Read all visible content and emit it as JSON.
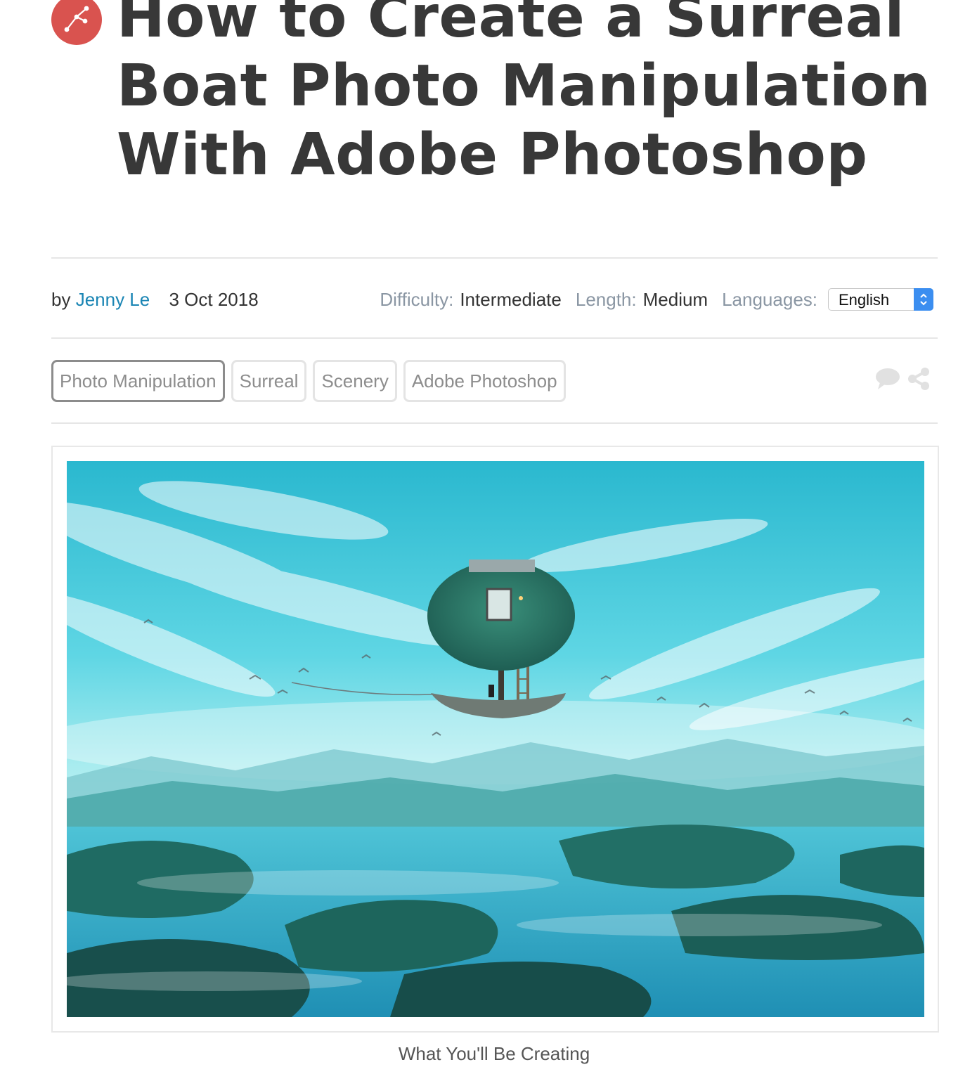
{
  "article": {
    "category_icon": "vector-node-icon",
    "title": "How to Create a Surreal Boat Photo Manipulation With Adobe Photoshop",
    "byline": {
      "by": "by",
      "author": "Jenny Le",
      "date": "3 Oct 2018"
    },
    "meta": {
      "difficulty_label": "Difficulty:",
      "difficulty_value": "Intermediate",
      "length_label": "Length:",
      "length_value": "Medium",
      "languages_label": "Languages:",
      "language_selected": "English"
    },
    "tags": [
      "Photo Manipulation",
      "Surreal",
      "Scenery",
      "Adobe Photoshop"
    ],
    "actions": {
      "comment_icon": "comment-icon",
      "share_icon": "share-icon"
    },
    "hero_caption": "What You'll Be Creating"
  },
  "colors": {
    "accent_red": "#d9534f",
    "link_blue": "#1a85b4",
    "label_gray": "#8a96a3",
    "select_blue": "#3b8ef0"
  }
}
